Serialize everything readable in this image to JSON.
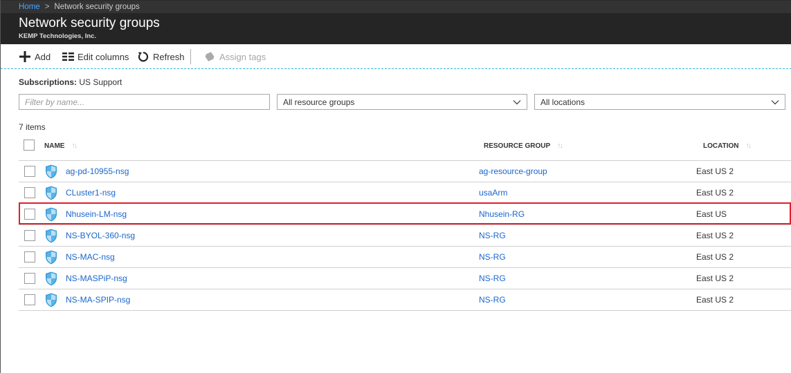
{
  "breadcrumb": {
    "home": "Home",
    "separator": ">",
    "current": "Network security groups"
  },
  "header": {
    "title": "Network security groups",
    "subtitle": "KEMP Technologies, Inc."
  },
  "toolbar": {
    "add_label": "Add",
    "edit_columns_label": "Edit columns",
    "refresh_label": "Refresh",
    "assign_tags_label": "Assign tags"
  },
  "subscriptions": {
    "label": "Subscriptions:",
    "value": "US Support"
  },
  "filters": {
    "name_placeholder": "Filter by name...",
    "resource_group_selected": "All resource groups",
    "location_selected": "All locations"
  },
  "items_count": "7 items",
  "table": {
    "columns": [
      {
        "label": "NAME",
        "sort_icon": "↑↓"
      },
      {
        "label": "RESOURCE GROUP",
        "sort_icon": "↑↓"
      },
      {
        "label": "LOCATION",
        "sort_icon": "↑↓"
      }
    ],
    "rows": [
      {
        "name": "ag-pd-10955-nsg",
        "resource_group": "ag-resource-group",
        "location": "East US 2"
      },
      {
        "name": "CLuster1-nsg",
        "resource_group": "usaArm",
        "location": "East US 2"
      },
      {
        "name": "Nhusein-LM-nsg",
        "resource_group": "Nhusein-RG",
        "location": "East US"
      },
      {
        "name": "NS-BYOL-360-nsg",
        "resource_group": "NS-RG",
        "location": "East US 2"
      },
      {
        "name": "NS-MAC-nsg",
        "resource_group": "NS-RG",
        "location": "East US 2"
      },
      {
        "name": "NS-MASPiP-nsg",
        "resource_group": "NS-RG",
        "location": "East US 2"
      },
      {
        "name": "NS-MA-SPIP-nsg",
        "resource_group": "NS-RG",
        "location": "East US 2"
      }
    ],
    "highlighted_row_index": 2
  },
  "colors": {
    "link": "#1a66cc",
    "highlight_border": "#e01e2b",
    "toolbar_separator": "#2bb6dc",
    "header_bg": "#252525"
  }
}
